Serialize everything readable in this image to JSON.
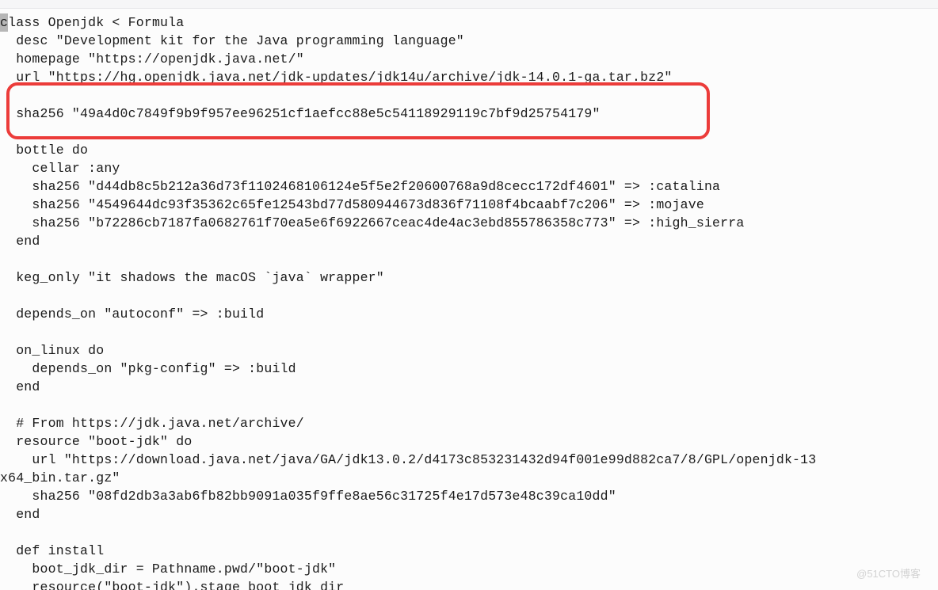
{
  "code": {
    "l01a": "c",
    "l01b": "lass Openjdk < Formula",
    "l02": "  desc \"Development kit for the Java programming language\"",
    "l03": "  homepage \"https://openjdk.java.net/\"",
    "l04": "  url \"https://hg.openjdk.java.net/jdk-updates/jdk14u/archive/jdk-14.0.1-ga.tar.bz2\"",
    "l05": "",
    "l06": "  sha256 \"49a4d0c7849f9b9f957ee96251cf1aefcc88e5c54118929119c7bf9d25754179\"",
    "l07": "",
    "l08": "  bottle do",
    "l09": "    cellar :any",
    "l10": "    sha256 \"d44db8c5b212a36d73f1102468106124e5f5e2f20600768a9d8cecc172df4601\" => :catalina",
    "l11": "    sha256 \"4549644dc93f35362c65fe12543bd77d580944673d836f71108f4bcaabf7c206\" => :mojave",
    "l12": "    sha256 \"b72286cb7187fa0682761f70ea5e6f6922667ceac4de4ac3ebd855786358c773\" => :high_sierra",
    "l13": "  end",
    "l14": "",
    "l15": "  keg_only \"it shadows the macOS `java` wrapper\"",
    "l16": "",
    "l17": "  depends_on \"autoconf\" => :build",
    "l18": "",
    "l19": "  on_linux do",
    "l20": "    depends_on \"pkg-config\" => :build",
    "l21": "  end",
    "l22": "",
    "l23": "  # From https://jdk.java.net/archive/",
    "l24": "  resource \"boot-jdk\" do",
    "l25": "    url \"https://download.java.net/java/GA/jdk13.0.2/d4173c853231432d94f001e99d882ca7/8/GPL/openjdk-13",
    "l26": "x64_bin.tar.gz\"",
    "l27": "    sha256 \"08fd2db3a3ab6fb82bb9091a035f9ffe8ae56c31725f4e17d573e48c39ca10dd\"",
    "l28": "  end",
    "l29": "",
    "l30": "  def install",
    "l31": "    boot_jdk_dir = Pathname.pwd/\"boot-jdk\"",
    "l32": "    resource(\"boot-jdk\").stage boot_jdk_dir"
  },
  "watermark": "@51CTO博客"
}
